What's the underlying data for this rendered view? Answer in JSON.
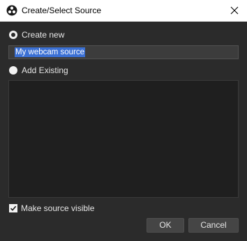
{
  "window": {
    "title": "Create/Select Source",
    "app_icon": "obs-logo-icon",
    "close_icon": "close-icon"
  },
  "create_new": {
    "label": "Create new",
    "selected": true,
    "name_value": "My webcam source"
  },
  "add_existing": {
    "label": "Add Existing",
    "selected": false,
    "items": []
  },
  "visibility": {
    "label": "Make source visible",
    "checked": true
  },
  "buttons": {
    "ok_label": "OK",
    "cancel_label": "Cancel"
  },
  "colors": {
    "background": "#2b2b2b",
    "list_background": "#1f1f1f",
    "selection": "#3b70d4"
  }
}
